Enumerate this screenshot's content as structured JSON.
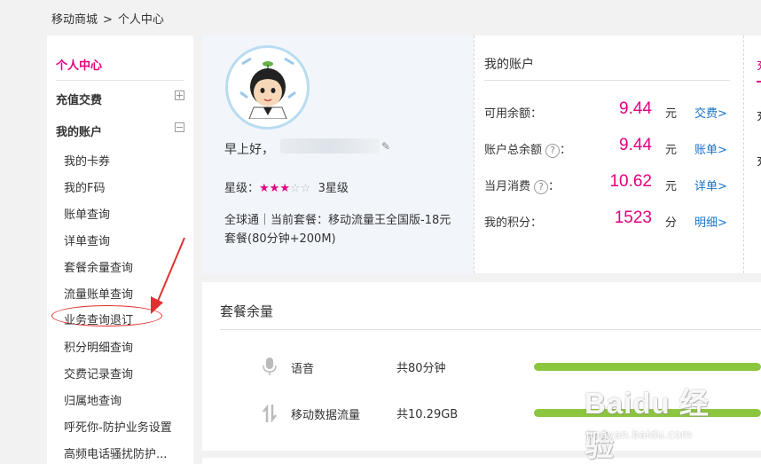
{
  "breadcrumb": {
    "root": "移动商城",
    "separator": ">",
    "current": "个人中心"
  },
  "sidebar": {
    "title": "个人中心",
    "group_recharge": "充值交费",
    "group_account": "我的账户",
    "items": [
      "我的卡券",
      "我的F码",
      "账单查询",
      "详单查询",
      "套餐余量查询",
      "流量账单查询",
      "业务查询退订",
      "积分明细查询",
      "交费记录查询",
      "归属地查询",
      "呼死你-防护业务设置",
      "高频电话骚扰防护..."
    ]
  },
  "profile": {
    "greeting": "早上好，",
    "pencil": "✎",
    "star_label": "星级：",
    "stars_on": "★★★",
    "stars_off": "☆☆",
    "star_text": "3星级",
    "plan": "全球通｜当前套餐：移动流量王全国版-18元套餐(80分钟+200M)"
  },
  "account": {
    "title": "我的账户",
    "help_glyph": "?",
    "rows": [
      {
        "label": "可用余额：",
        "value": "9.44",
        "unit": "元",
        "link": "交费>"
      },
      {
        "label": "账户总余额",
        "suffix": "：",
        "value": "9.44",
        "unit": "元",
        "link": "账单>"
      },
      {
        "label": "当月消费",
        "suffix": "：",
        "value": "10.62",
        "unit": "元",
        "link": "详单>"
      },
      {
        "label": "我的积分：",
        "value": "1523",
        "unit": "分",
        "link": "明细>"
      }
    ]
  },
  "right_strip": {
    "title": "充",
    "row1": "充",
    "row2": "充"
  },
  "package": {
    "title": "套餐余量",
    "items": [
      {
        "icon": "microphone-icon",
        "name": "语音",
        "total": "共80分钟",
        "remaining_fraction": 1.0
      },
      {
        "icon": "data-transfer-icon",
        "name": "移动数据流量",
        "total": "共10.29GB",
        "remaining_fraction": 1.0
      }
    ]
  },
  "watermark": {
    "main": "Baidu 经验",
    "sub": "jingyan.baidu.com"
  },
  "colors": {
    "accent": "#e4007f",
    "link": "#1a73c8",
    "progress": "#8cc63f",
    "annotation": "#e03030"
  }
}
